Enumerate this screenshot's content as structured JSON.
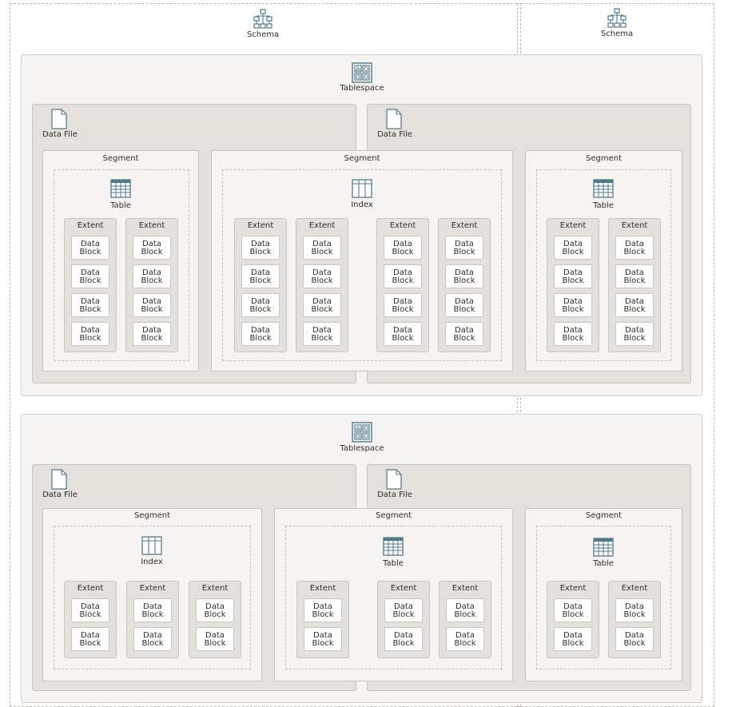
{
  "labels": {
    "schema": "Schema",
    "tablespace": "Tablespace",
    "data_file": "Data File",
    "segment": "Segment",
    "extent": "Extent",
    "table": "Table",
    "index": "Index",
    "data_block_line1": "Data",
    "data_block_line2": "Block"
  },
  "schemas": [
    "Schema",
    "Schema"
  ],
  "tablespaces": [
    {
      "label": "Tablespace",
      "data_files": [
        "Data File",
        "Data File"
      ],
      "segments": [
        {
          "label": "Segment",
          "object": "Table",
          "extents": [
            {
              "label": "Extent",
              "blocks": 4
            },
            {
              "label": "Extent",
              "blocks": 4
            }
          ]
        },
        {
          "label": "Segment",
          "object": "Index",
          "extents": [
            {
              "label": "Extent",
              "blocks": 4
            },
            {
              "label": "Extent",
              "blocks": 4
            },
            {
              "label": "Extent",
              "blocks": 4
            },
            {
              "label": "Extent",
              "blocks": 4
            }
          ]
        },
        {
          "label": "Segment",
          "object": "Table",
          "extents": [
            {
              "label": "Extent",
              "blocks": 4
            },
            {
              "label": "Extent",
              "blocks": 4
            }
          ]
        }
      ]
    },
    {
      "label": "Tablespace",
      "data_files": [
        "Data File",
        "Data File"
      ],
      "segments": [
        {
          "label": "Segment",
          "object": "Index",
          "extents": [
            {
              "label": "Extent",
              "blocks": 2
            },
            {
              "label": "Extent",
              "blocks": 2
            },
            {
              "label": "Extent",
              "blocks": 2
            }
          ]
        },
        {
          "label": "Segment",
          "object": "Table",
          "extents": [
            {
              "label": "Extent",
              "blocks": 2
            },
            {
              "label": "Extent",
              "blocks": 2
            },
            {
              "label": "Extent",
              "blocks": 2
            }
          ]
        },
        {
          "label": "Segment",
          "object": "Table",
          "extents": [
            {
              "label": "Extent",
              "blocks": 2
            },
            {
              "label": "Extent",
              "blocks": 2
            }
          ]
        }
      ]
    }
  ],
  "colors": {
    "tablespace_bg": "#f5f4f2",
    "datafile_bg": "#e4e1dc",
    "icon": "#4f7a8a",
    "border": "#c7c3be"
  }
}
